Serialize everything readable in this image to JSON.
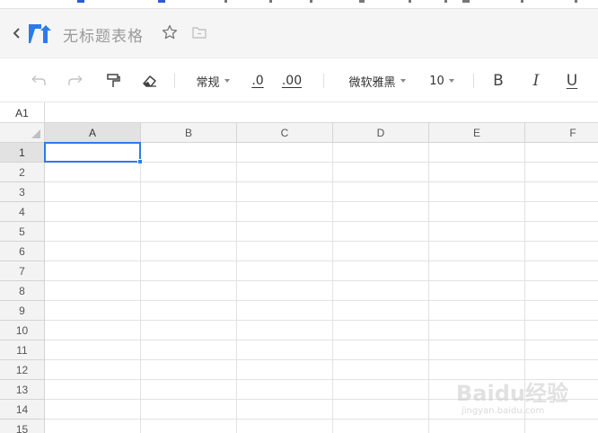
{
  "document": {
    "title": "无标题表格"
  },
  "toolbar": {
    "number_format": "常规",
    "decrease_decimal": ".0",
    "increase_decimal": ".00",
    "font_family": "微软雅黑",
    "font_size": "10",
    "bold": "B",
    "italic": "I",
    "underline": "U"
  },
  "name_box": "A1",
  "columns": [
    "A",
    "B",
    "C",
    "D",
    "E",
    "F"
  ],
  "rows": [
    "1",
    "2",
    "3",
    "4",
    "5",
    "6",
    "7",
    "8",
    "9",
    "10",
    "11",
    "12",
    "13",
    "14",
    "15"
  ],
  "selected_cell": {
    "column": "A",
    "row": "1"
  },
  "colors": {
    "accent": "#2b7ce9",
    "logo": "#2b7ce9",
    "header_bg": "#f3f3f3",
    "title_text": "#9a9a9a"
  },
  "watermark": {
    "main": "Baidu经验",
    "sub": "jingyan.baidu.com"
  },
  "icons": {
    "back": "chevron-left-icon",
    "logo": "app-logo-icon",
    "star": "star-icon",
    "folder": "folder-icon",
    "undo": "undo-icon",
    "redo": "redo-icon",
    "format_painter": "format-painter-icon",
    "clear_format": "eraser-icon"
  }
}
